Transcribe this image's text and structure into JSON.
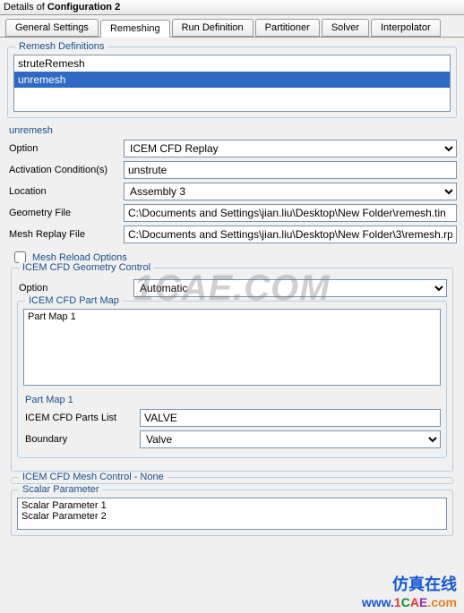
{
  "title": {
    "prefix": "Details of ",
    "config": "Configuration 2"
  },
  "tabs": [
    "General Settings",
    "Remeshing",
    "Run Definition",
    "Partitioner",
    "Solver",
    "Interpolator"
  ],
  "active_tab_index": 1,
  "remesh_definitions": {
    "legend": "Remesh Definitions",
    "items": [
      "struteRemesh",
      "unremesh"
    ],
    "selected_index": 1
  },
  "section_unremesh_title": "unremesh",
  "fields": {
    "option_label": "Option",
    "option_value": "ICEM CFD Replay",
    "activation_label": "Activation Condition(s)",
    "activation_value": "unstrute",
    "location_label": "Location",
    "location_value": "Assembly 3",
    "geometry_label": "Geometry File",
    "geometry_value": "C:\\Documents and Settings\\jian.liu\\Desktop\\New Folder\\remesh.tin",
    "meshreplay_label": "Mesh Replay File",
    "meshreplay_value": "C:\\Documents and Settings\\jian.liu\\Desktop\\New Folder\\3\\remesh.rpl"
  },
  "mesh_reload": {
    "label": "Mesh Reload Options",
    "checked": false
  },
  "geom_control": {
    "legend": "ICEM CFD Geometry Control",
    "option_label": "Option",
    "option_value": "Automatic"
  },
  "part_map": {
    "legend": "ICEM CFD Part Map",
    "items": [
      "Part Map 1"
    ],
    "subsection_title": "Part Map 1",
    "parts_list_label": "ICEM CFD Parts List",
    "parts_list_value": "VALVE",
    "boundary_label": "Boundary",
    "boundary_value": "Valve"
  },
  "mesh_control": {
    "legend": "ICEM CFD Mesh Control - None"
  },
  "scalar_param": {
    "legend": "Scalar Parameter",
    "items": [
      "Scalar Parameter 1",
      "Scalar Parameter 2"
    ]
  },
  "watermark": "1CAE.COM",
  "brand": {
    "cn": "仿真在线",
    "url_plain": "www.1CAE.com"
  }
}
